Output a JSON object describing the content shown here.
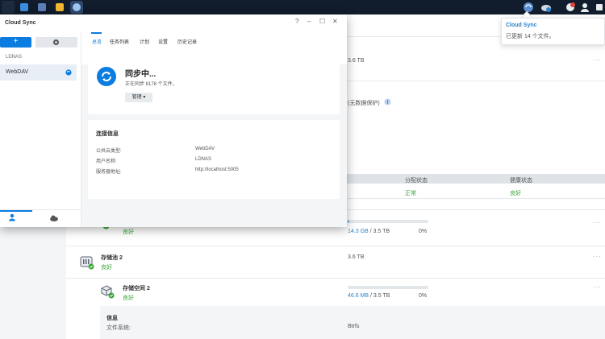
{
  "bg": {
    "total_capacity": "3.6 TB",
    "no_data_protection": "(无数据保护)",
    "table_headers": {
      "allocation_status": "分配状态",
      "health_status": "健康状态"
    },
    "table_row": {
      "allocation_status": "正常",
      "health_status": "良好"
    },
    "volume1": {
      "status": "良好",
      "used": "14.3 GB",
      "total": "/ 3.5 TB",
      "percent": "0%",
      "usage_fraction": 0.004
    },
    "pool2": {
      "name": "存储池 2",
      "status": "良好",
      "capacity": "3.6 TB"
    },
    "volume2": {
      "name": "存储空间 2",
      "status": "良好",
      "used": "46.6 MB",
      "total": "/ 3.5 TB",
      "percent": "0%",
      "usage_fraction": 0.0
    },
    "info": {
      "title": "信息",
      "fs_label": "文件系统:",
      "fs_value": "Btrfs"
    },
    "more": "···"
  },
  "notification": {
    "title": "Cloud Sync",
    "message": "已更新 14 个文件。"
  },
  "window": {
    "title": "Cloud Sync",
    "controls": {
      "help": "?",
      "minimize": "–",
      "maximize": "☐",
      "close": "✕"
    },
    "sidebar": {
      "add_label": "+",
      "section": "LDNAS",
      "item": "WebDAV"
    },
    "tabs": [
      "总览",
      "任务列表",
      "计划",
      "设置",
      "历史记录"
    ],
    "status": {
      "title": "同步中...",
      "detail": "正在同步 8178 个文件。",
      "manage": "管理 ▾"
    },
    "connection": {
      "title": "连接信息",
      "rows": [
        {
          "label": "公共云类型:",
          "value": "WebDAV"
        },
        {
          "label": "用户名称:",
          "value": "LDNAS"
        },
        {
          "label": "服务器地址:",
          "value": "http://localhost:5005"
        }
      ]
    }
  },
  "colors": {
    "accent": "#0b7de0",
    "green": "#3aa536",
    "taskbar": "#111c2c"
  }
}
